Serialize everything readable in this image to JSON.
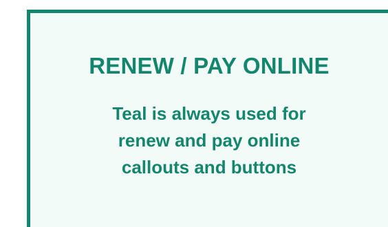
{
  "callout": {
    "title": "RENEW / PAY ONLINE",
    "description_lines": [
      "Teal is always used for",
      "renew and pay online",
      "callouts and buttons"
    ],
    "colors": {
      "accent": "#13866d",
      "background": "#f3fbf9"
    }
  }
}
